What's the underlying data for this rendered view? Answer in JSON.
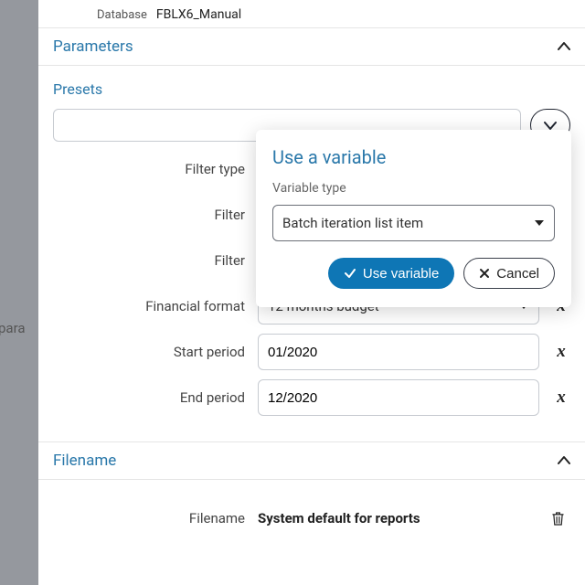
{
  "database": {
    "label": "Database",
    "value": "FBLX6_Manual"
  },
  "sections": {
    "parameters": {
      "title": "Parameters"
    },
    "filename": {
      "title": "Filename"
    }
  },
  "presets": {
    "label": "Presets",
    "value": ""
  },
  "fields": {
    "filter_type": {
      "label": "Filter type"
    },
    "filter": {
      "label": "Filter"
    },
    "filter2": {
      "label": "Filter"
    },
    "financial_format": {
      "label": "Financial format",
      "value": "12 months budget"
    },
    "start_period": {
      "label": "Start period",
      "value": "01/2020"
    },
    "end_period": {
      "label": "End period",
      "value": "12/2020"
    },
    "filename": {
      "label": "Filename",
      "value": "System default for reports"
    }
  },
  "popover": {
    "title": "Use a variable",
    "type_label": "Variable type",
    "type_value": "Batch iteration list item",
    "use_label": "Use variable",
    "cancel_label": "Cancel"
  },
  "outside": {
    "text": "para"
  }
}
